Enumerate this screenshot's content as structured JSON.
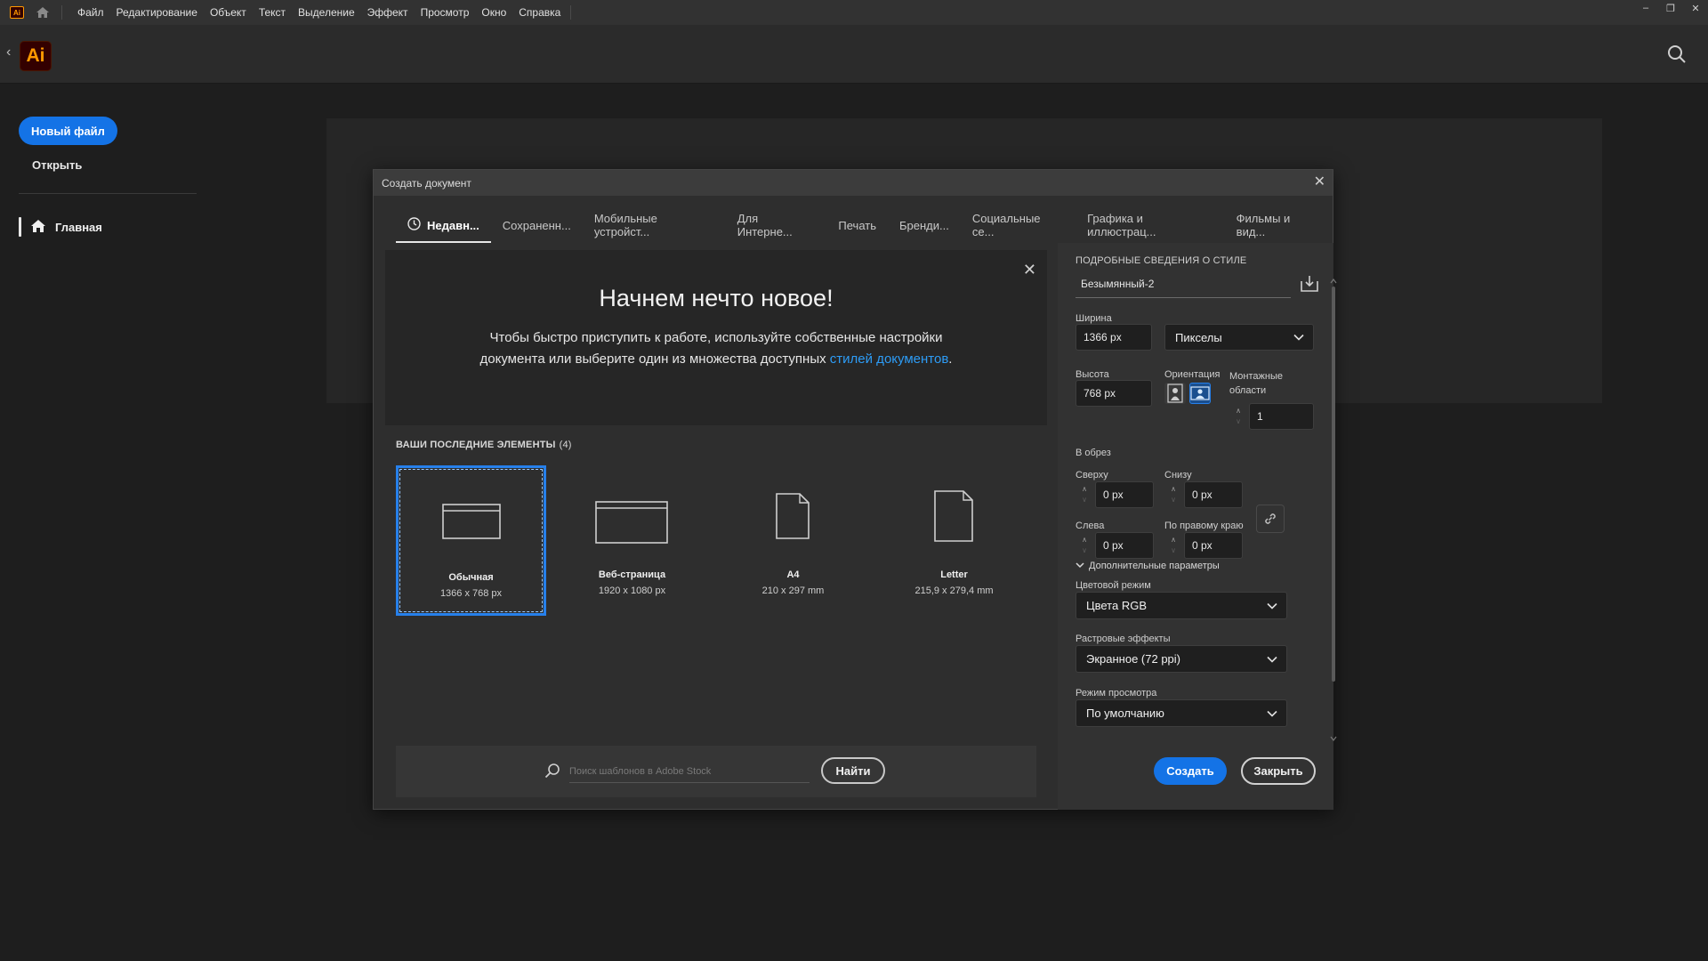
{
  "menubar": {
    "items": [
      "Файл",
      "Редактирование",
      "Объект",
      "Текст",
      "Выделение",
      "Эффект",
      "Просмотр",
      "Окно",
      "Справка"
    ],
    "app_mini": "Ai"
  },
  "header": {
    "logo": "Ai"
  },
  "sidebar": {
    "new_file": "Новый файл",
    "open": "Открыть",
    "home": "Главная"
  },
  "dialog": {
    "title": "Создать документ",
    "tabs": [
      "Недавн...",
      "Сохраненн...",
      "Мобильные устройст...",
      "Для Интерне...",
      "Печать",
      "Бренди...",
      "Социальные се...",
      "Графика и иллюстрац...",
      "Фильмы и вид..."
    ],
    "welcome": {
      "heading": "Начнем нечто новое!",
      "text_before": "Чтобы быстро приступить к работе, используйте собственные настройки документа или выберите один из множества доступных ",
      "link": "стилей документов",
      "text_after": "."
    },
    "recent_header": "ВАШИ ПОСЛЕДНИЕ ЭЛЕМЕНТЫ",
    "recent_count": "(4)",
    "presets": [
      {
        "name": "Обычная",
        "size": "1366 x 768 px"
      },
      {
        "name": "Веб-страница",
        "size": "1920 x 1080 px"
      },
      {
        "name": "A4",
        "size": "210 x 297 mm"
      },
      {
        "name": "Letter",
        "size": "215,9 x 279,4 mm"
      }
    ],
    "stock": {
      "placeholder": "Поиск шаблонов в Adobe Stock",
      "find": "Найти"
    },
    "details": {
      "header": "ПОДРОБНЫЕ СВЕДЕНИЯ О СТИЛЕ",
      "name": "Безымянный-2",
      "width_label": "Ширина",
      "width": "1366 px",
      "units": "Пикселы",
      "height_label": "Высота",
      "height": "768 px",
      "orientation_label": "Ориентация",
      "artboards_label_1": "Монтажные",
      "artboards_label_2": "области",
      "artboards": "1",
      "bleed_label": "В обрез",
      "top_label": "Сверху",
      "top": "0 px",
      "bottom_label": "Снизу",
      "bottom": "0 px",
      "left_label": "Слева",
      "left": "0 px",
      "right_label": "По правому краю",
      "right": "0 px",
      "advanced": "Дополнительные параметры",
      "color_mode_label": "Цветовой режим",
      "color_mode": "Цвета RGB",
      "raster_label": "Растровые эффекты",
      "raster": "Экранное (72 ppi)",
      "preview_label": "Режим просмотра",
      "preview": "По умолчанию"
    },
    "create": "Создать",
    "close": "Закрыть"
  },
  "colors": {
    "accent": "#1473e6",
    "link": "#2d9cf6",
    "ai_orange": "#ff9a00",
    "ai_bg": "#330000"
  }
}
